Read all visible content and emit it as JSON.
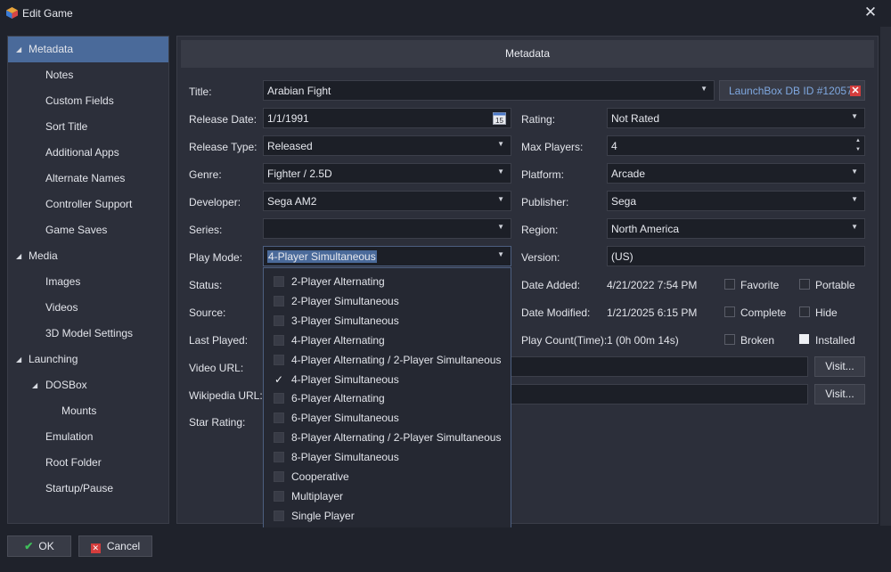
{
  "window": {
    "title": "Edit Game",
    "close_icon": "close-icon"
  },
  "sidebar": {
    "items": [
      {
        "label": "Metadata",
        "caret": true,
        "selected": true
      },
      {
        "label": "Notes"
      },
      {
        "label": "Custom Fields"
      },
      {
        "label": "Sort Title"
      },
      {
        "label": "Additional Apps"
      },
      {
        "label": "Alternate Names"
      },
      {
        "label": "Controller Support"
      },
      {
        "label": "Game Saves"
      },
      {
        "label": "Media",
        "caret": true
      },
      {
        "label": "Images"
      },
      {
        "label": "Videos"
      },
      {
        "label": "3D Model Settings"
      },
      {
        "label": "Launching",
        "caret": true
      },
      {
        "label": "DOSBox",
        "caret": true
      },
      {
        "label": "Mounts"
      },
      {
        "label": "Emulation"
      },
      {
        "label": "Root Folder"
      },
      {
        "label": "Startup/Pause"
      }
    ]
  },
  "header": {
    "title": "Metadata"
  },
  "form": {
    "title_label": "Title:",
    "title_value": "Arabian Fight",
    "launchbox_id": "LaunchBox DB ID #12057",
    "release_date_label": "Release Date:",
    "release_date_value": "1/1/1991",
    "calendar_day": "15",
    "rating_label": "Rating:",
    "rating_value": "Not Rated",
    "release_type_label": "Release Type:",
    "release_type_value": "Released",
    "max_players_label": "Max Players:",
    "max_players_value": "4",
    "genre_label": "Genre:",
    "genre_value": "Fighter / 2.5D",
    "platform_label": "Platform:",
    "platform_value": "Arcade",
    "developer_label": "Developer:",
    "developer_value": "Sega AM2",
    "publisher_label": "Publisher:",
    "publisher_value": "Sega",
    "series_label": "Series:",
    "series_value": "",
    "region_label": "Region:",
    "region_value": "North America",
    "play_mode_label": "Play Mode:",
    "play_mode_value": "4-Player Simultaneous",
    "version_label": "Version:",
    "version_value": "(US)",
    "status_label": "Status:",
    "date_added_label": "Date Added:",
    "date_added_value": "4/21/2022 7:54 PM",
    "source_label": "Source:",
    "date_modified_label": "Date Modified:",
    "date_modified_value": "1/21/2025 6:15 PM",
    "last_played_label": "Last Played:",
    "play_count_label": "Play Count(Time):",
    "play_count_value": "1 (0h 00m 14s)",
    "video_url_label": "Video URL:",
    "wikipedia_url_label": "Wikipedia URL:",
    "star_rating_label": "Star Rating:",
    "visit_label": "Visit...",
    "flags": {
      "favorite": {
        "label": "Favorite",
        "checked": false
      },
      "portable": {
        "label": "Portable",
        "checked": false
      },
      "complete": {
        "label": "Complete",
        "checked": false
      },
      "hide": {
        "label": "Hide",
        "checked": false
      },
      "broken": {
        "label": "Broken",
        "checked": false
      },
      "installed": {
        "label": "Installed",
        "checked": true
      }
    }
  },
  "play_mode_options": [
    {
      "label": "2-Player Alternating",
      "checked": false
    },
    {
      "label": "2-Player Simultaneous",
      "checked": false
    },
    {
      "label": "3-Player Simultaneous",
      "checked": false
    },
    {
      "label": "4-Player Alternating",
      "checked": false
    },
    {
      "label": "4-Player Alternating / 2-Player Simultaneous",
      "checked": false
    },
    {
      "label": "4-Player Simultaneous",
      "checked": true
    },
    {
      "label": "6-Player Alternating",
      "checked": false
    },
    {
      "label": "6-Player Simultaneous",
      "checked": false
    },
    {
      "label": "8-Player Alternating / 2-Player Simultaneous",
      "checked": false
    },
    {
      "label": "8-Player Simultaneous",
      "checked": false
    },
    {
      "label": "Cooperative",
      "checked": false
    },
    {
      "label": "Multiplayer",
      "checked": false
    },
    {
      "label": "Single Player",
      "checked": false
    }
  ],
  "footer": {
    "ok_label": "OK",
    "cancel_label": "Cancel"
  },
  "colors": {
    "accent": "#4a6a9a",
    "link": "#7fa8e0",
    "danger": "#d43d3d",
    "ok": "#3fbf5a"
  }
}
